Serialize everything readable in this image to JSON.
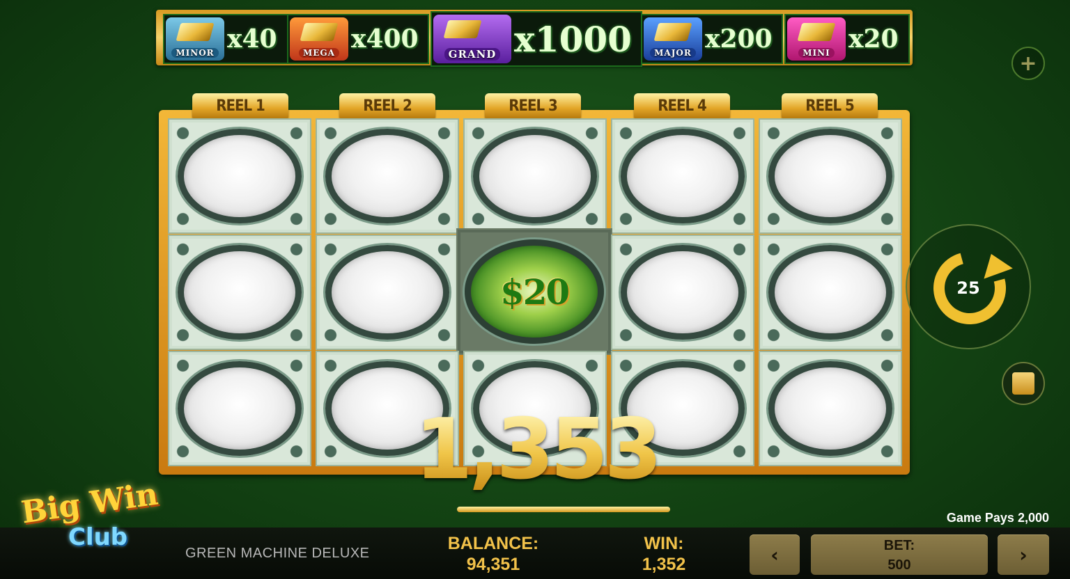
{
  "jackpots": [
    {
      "label": "MINOR",
      "multiplier": "x40"
    },
    {
      "label": "MEGA",
      "multiplier": "x400"
    },
    {
      "label": "GRAND",
      "multiplier": "x1000"
    },
    {
      "label": "MAJOR",
      "multiplier": "x200"
    },
    {
      "label": "MINI",
      "multiplier": "x20"
    }
  ],
  "plus_icon": "+",
  "reels": [
    "REEL 1",
    "REEL 2",
    "REEL 3",
    "REEL 4",
    "REEL 5"
  ],
  "win_symbol": "$20",
  "win_counter": "1,353",
  "spin": {
    "count": "25"
  },
  "logo": {
    "line1": "Big Win",
    "line2": "Club"
  },
  "game_pays": "Game Pays 2,000",
  "game_name": "GREEN MACHINE DELUXE",
  "balance": {
    "label": "BALANCE:",
    "value": "94,351"
  },
  "win": {
    "label": "WIN:",
    "value": "1,352"
  },
  "bet": {
    "label": "BET:",
    "value": "500",
    "prev": "‹",
    "next": "›"
  },
  "colors": {
    "accent_gold": "#f0c030",
    "table_green": "#134313"
  }
}
